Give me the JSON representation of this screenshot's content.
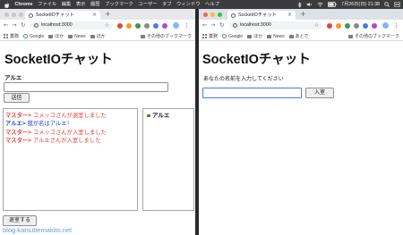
{
  "menubar": {
    "app_name": "Chrome",
    "items": [
      "ファイル",
      "編集",
      "表示",
      "履歴",
      "ブックマーク",
      "ユーザー",
      "タブ",
      "ウィンドウ",
      "ヘルプ"
    ],
    "clock": "7月26日(日) 21:38"
  },
  "colors": {
    "traffic_red": "#ff5f57",
    "traffic_yellow": "#febc2e",
    "traffic_green": "#28c840",
    "traffic_inactive": "#c6c6c6",
    "focus_ring": "#4a7be8",
    "watermark": "#5fa0d8"
  },
  "left_window": {
    "tab_title": "SocketIOチャット",
    "url": "localhost:3000",
    "bookmarks": [
      {
        "label": "業務",
        "icon": "apps-grid-icon"
      },
      {
        "label": "Google",
        "icon": "google-icon"
      },
      {
        "label": "ほか",
        "icon": "folder-icon"
      },
      {
        "label": "News",
        "icon": "folder-icon"
      },
      {
        "label": "ほか",
        "icon": "folder-icon"
      }
    ],
    "other_bookmarks": "その他のブックマーク",
    "page": {
      "title": "SocketIOチャット",
      "user_name": "アルエ",
      "message_value": "",
      "send_button": "送信",
      "chat_log": [
        {
          "speaker": "マスター>",
          "message": "コメッコさんが退室しました",
          "color": "#e53935"
        },
        {
          "speaker": "アルエ>",
          "message": "我が名はアルエ！",
          "color": "#1e3ccf"
        },
        {
          "speaker": "マスター>",
          "message": "コメッコさんが入室しました",
          "color": "#e53935"
        },
        {
          "speaker": "マスター>",
          "message": "アルエさんが入室しました",
          "color": "#e53935"
        }
      ],
      "members": [
        {
          "name": "アルエ",
          "status_color": "#2e7d32"
        }
      ],
      "leave_button": "退室する"
    }
  },
  "right_window": {
    "tab_title": "SocketIOチャット",
    "url": "localhost:3000",
    "bookmarks": [
      {
        "label": "業務",
        "icon": "apps-grid-icon"
      },
      {
        "label": "Google",
        "icon": "google-icon"
      },
      {
        "label": "ほか",
        "icon": "folder-icon"
      },
      {
        "label": "News",
        "icon": "folder-icon"
      },
      {
        "label": "あとで",
        "icon": "folder-icon"
      }
    ],
    "other_bookmarks": "その他のブックマーク",
    "page": {
      "title": "SocketIOチャット",
      "prompt": "あなたの名前を入力してください",
      "name_value": "",
      "enter_button": "入室"
    }
  },
  "watermark": "blog.katsubemakito.net"
}
